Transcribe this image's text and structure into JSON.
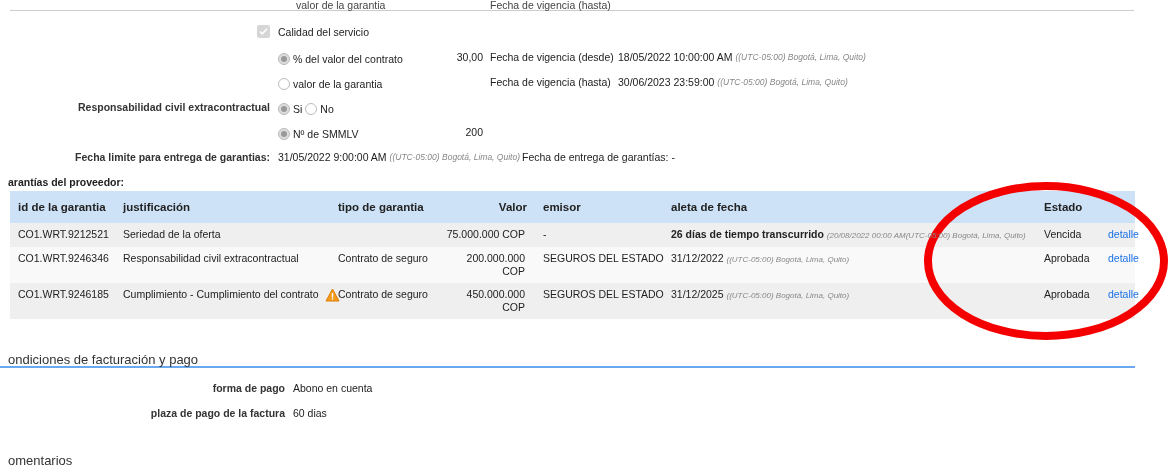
{
  "top_row": {
    "option": "valor de la garantia",
    "date_label": "Fecha de vigencia (hasta)"
  },
  "quality": {
    "label": "Calidad del servicio",
    "checked": true,
    "disabled": true
  },
  "quality_options": [
    {
      "label": "% del valor del contrato",
      "selected": true,
      "value": "30,00",
      "date_label": "Fecha de vigencia (desde)",
      "date": "18/05/2022 10:00:00 AM",
      "timezone": "((UTC-05:00) Bogotá, Lima, Quito)"
    },
    {
      "label": "valor de la garantia",
      "selected": false,
      "date_label": "Fecha de vigencia (hasta)",
      "date": "30/06/2023 23:59:00",
      "timezone": "((UTC-05:00) Bogotá, Lima, Quito)"
    }
  ],
  "liability": {
    "label": "Responsabilidad civil extracontractual",
    "options": [
      {
        "label": "Si",
        "selected": true
      },
      {
        "label": "No",
        "selected": false
      }
    ]
  },
  "smmlv": {
    "label": "Nº de SMMLV",
    "selected": true,
    "value": "200"
  },
  "deadline": {
    "label": "Fecha limite para entrega de garantias:",
    "date": "31/05/2022 9:00:00 AM",
    "timezone": "((UTC-05:00) Bogotá, Lima, Quito)",
    "delivery_label": "Fecha de entrega de garantías: -"
  },
  "guarantees": {
    "title": "arantías del proveedor:",
    "columns": [
      "id de la garantia",
      "justificación",
      "tipo de garantia",
      "Valor",
      "emisor",
      "aleta de fecha",
      "Estado"
    ],
    "rows": [
      {
        "id": "CO1.WRT.9212521",
        "justification": "Seriedad de la oferta",
        "warning": false,
        "type": "",
        "value": "75.000.000 COP",
        "issuer": "-",
        "date": "26 días de tiempo transcurrido",
        "date_note": "(20/08/2022 00:00 AM(UTC-05:00) Bogotá, Lima, Quito)",
        "status": "Vencida",
        "link": "detalle"
      },
      {
        "id": "CO1.WRT.9246346",
        "justification": "Responsabilidad civil extracontractual",
        "warning": false,
        "type": "Contrato de seguro",
        "value": "200.000.000 COP",
        "issuer": "SEGUROS DEL ESTADO",
        "date": "31/12/2022",
        "date_note": "((UTC-05:00) Bogotá, Lima, Quito)",
        "status": "Aprobada",
        "link": "detalle"
      },
      {
        "id": "CO1.WRT.9246185",
        "justification": "Cumplimiento - Cumplimiento del contrato",
        "warning": true,
        "type": "Contrato de seguro",
        "value": "450.000.000 COP",
        "issuer": "SEGUROS DEL ESTADO",
        "date": "31/12/2025",
        "date_note": "((UTC-05:00) Bogotá, Lima, Quito)",
        "status": "Aprobada",
        "link": "detalle"
      }
    ]
  },
  "billing": {
    "title": "ondiciones de facturación y pago",
    "fields": [
      {
        "label": "forma de pago",
        "value": "Abono en cuenta"
      },
      {
        "label": "plaza de pago de la factura",
        "value": "60 dias"
      }
    ]
  },
  "comments": {
    "title": "omentarios"
  }
}
